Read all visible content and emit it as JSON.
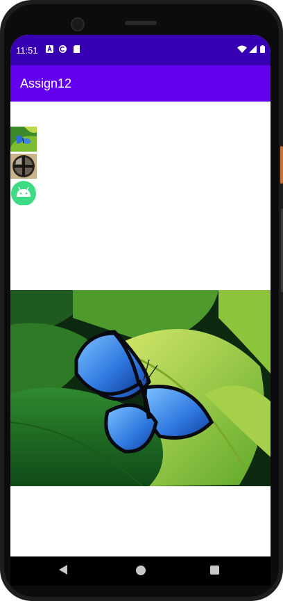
{
  "status_bar": {
    "time": "11:51",
    "notification_icons": [
      "a-notification-icon",
      "c-notification-icon",
      "sd-card-icon"
    ],
    "system_icons": [
      "wifi-icon",
      "cell-signal-icon",
      "battery-icon"
    ],
    "color": "#3700b3"
  },
  "app_bar": {
    "title": "Assign12",
    "color": "#6200ee"
  },
  "thumbnails": [
    {
      "icon": "butterfly-thumbnail"
    },
    {
      "icon": "window-thumbnail"
    },
    {
      "icon": "android-thumbnail"
    }
  ],
  "main_image": {
    "icon": "butterfly-image"
  },
  "nav_bar": {
    "buttons": [
      "back-icon",
      "home-icon",
      "recents-icon"
    ]
  }
}
